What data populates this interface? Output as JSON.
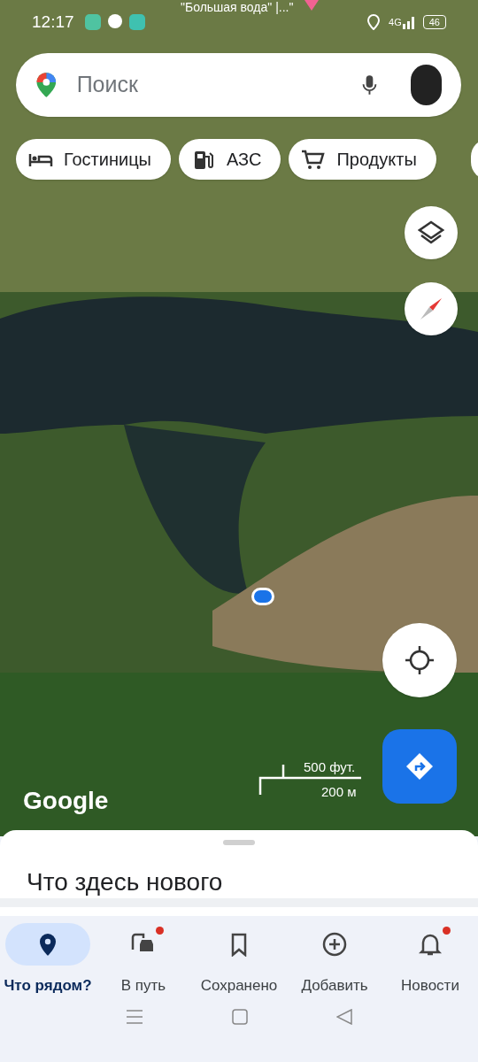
{
  "status_bar": {
    "time": "12:17",
    "network": "4G",
    "battery": "46"
  },
  "map": {
    "place_label": "\"Большая вода\" |...\"",
    "scale_imperial": "500 фут.",
    "scale_metric": "200 м",
    "logo": "Google"
  },
  "search": {
    "placeholder": "Поиск"
  },
  "chips": [
    {
      "label": "Гостиницы",
      "kind": "hotel"
    },
    {
      "label": "АЗС",
      "kind": "fuel"
    },
    {
      "label": "Продукты",
      "kind": "grocery"
    }
  ],
  "sheet": {
    "title": "Что здесь нового"
  },
  "nav": [
    {
      "label": "Что рядом?",
      "kind": "explore",
      "selected": true,
      "badge": false
    },
    {
      "label": "В путь",
      "kind": "commute",
      "selected": false,
      "badge": true
    },
    {
      "label": "Сохранено",
      "kind": "saved",
      "selected": false,
      "badge": false
    },
    {
      "label": "Добавить",
      "kind": "add",
      "selected": false,
      "badge": false
    },
    {
      "label": "Новости",
      "kind": "updates",
      "selected": false,
      "badge": true
    }
  ]
}
